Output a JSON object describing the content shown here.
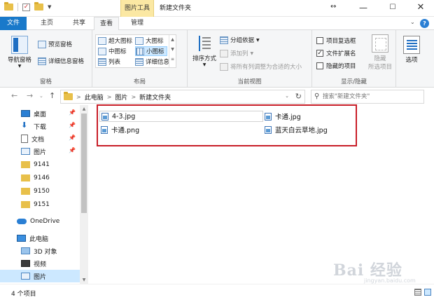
{
  "titlebar": {
    "context_tab": "图片工具",
    "title": "新建文件夹",
    "minimize": "—",
    "maximize": "☐",
    "close": "✕"
  },
  "tabs": {
    "file": "文件",
    "home": "主页",
    "share": "共享",
    "view": "查看",
    "manage": "管理"
  },
  "ribbon": {
    "pane": {
      "nav_pane": "导航窗格",
      "preview_pane": "预览窗格",
      "details_pane": "详细信息窗格",
      "label": "窗格"
    },
    "layout": {
      "extra_large_icons": "超大图标",
      "large_icons": "大图标",
      "medium_icons": "中图标",
      "small_icons": "小图标",
      "list": "列表",
      "details": "详细信息",
      "label": "布局"
    },
    "current_view": {
      "sort_by": "排序方式",
      "group_by": "分组依据",
      "add_columns": "添加列",
      "size_all_columns": "将所有列调整为合适的大小",
      "label": "当前视图"
    },
    "show_hide": {
      "item_checkboxes": "项目复选框",
      "file_extensions": "文件扩展名",
      "hidden_items": "隐藏的项目",
      "hide_selected_line1": "隐藏",
      "hide_selected_line2": "所选项目",
      "options": "选项",
      "label": "显示/隐藏"
    }
  },
  "checkboxes": {
    "item_checkboxes": false,
    "file_extensions": true,
    "hidden_items": false
  },
  "address": {
    "crumbs": [
      "此电脑",
      "图片",
      "新建文件夹"
    ],
    "separator": ">",
    "search_placeholder": "搜索\"新建文件夹\""
  },
  "nav": {
    "items": [
      {
        "label": "桌面",
        "icon": "desktop-icon",
        "pinned": true
      },
      {
        "label": "下载",
        "icon": "download-icon",
        "pinned": true
      },
      {
        "label": "文档",
        "icon": "document-icon",
        "pinned": true
      },
      {
        "label": "图片",
        "icon": "pictures-icon",
        "pinned": true
      },
      {
        "label": "9141",
        "icon": "folder-icon",
        "pinned": false
      },
      {
        "label": "9146",
        "icon": "folder-icon",
        "pinned": false
      },
      {
        "label": "9150",
        "icon": "folder-icon",
        "pinned": false
      },
      {
        "label": "9151",
        "icon": "folder-icon",
        "pinned": false
      },
      {
        "label": "OneDrive",
        "icon": "onedrive-icon",
        "pinned": false
      },
      {
        "label": "此电脑",
        "icon": "this-pc-icon",
        "pinned": false
      },
      {
        "label": "3D 对象",
        "icon": "3d-objects-icon",
        "pinned": false
      },
      {
        "label": "视频",
        "icon": "videos-icon",
        "pinned": false
      },
      {
        "label": "图片",
        "icon": "pictures-icon",
        "pinned": false
      }
    ],
    "pin_glyph": "📌"
  },
  "files": [
    {
      "name": "4-3.jpg",
      "icon": "image-file-icon"
    },
    {
      "name": "卡通.png",
      "icon": "image-file-icon"
    },
    {
      "name": "卡通.jpg",
      "icon": "image-file-icon"
    },
    {
      "name": "蓝天白云草地.jpg",
      "icon": "image-file-icon"
    }
  ],
  "status": {
    "item_count": "4 个项目"
  },
  "watermark": {
    "main": "Bai 经验",
    "sub": "jingyan.baidu.com"
  },
  "colors": {
    "file_tab": "#1979ca",
    "context_tab": "#fbe8a3",
    "selection": "#cce8ff",
    "highlight_border": "#c81e28"
  }
}
